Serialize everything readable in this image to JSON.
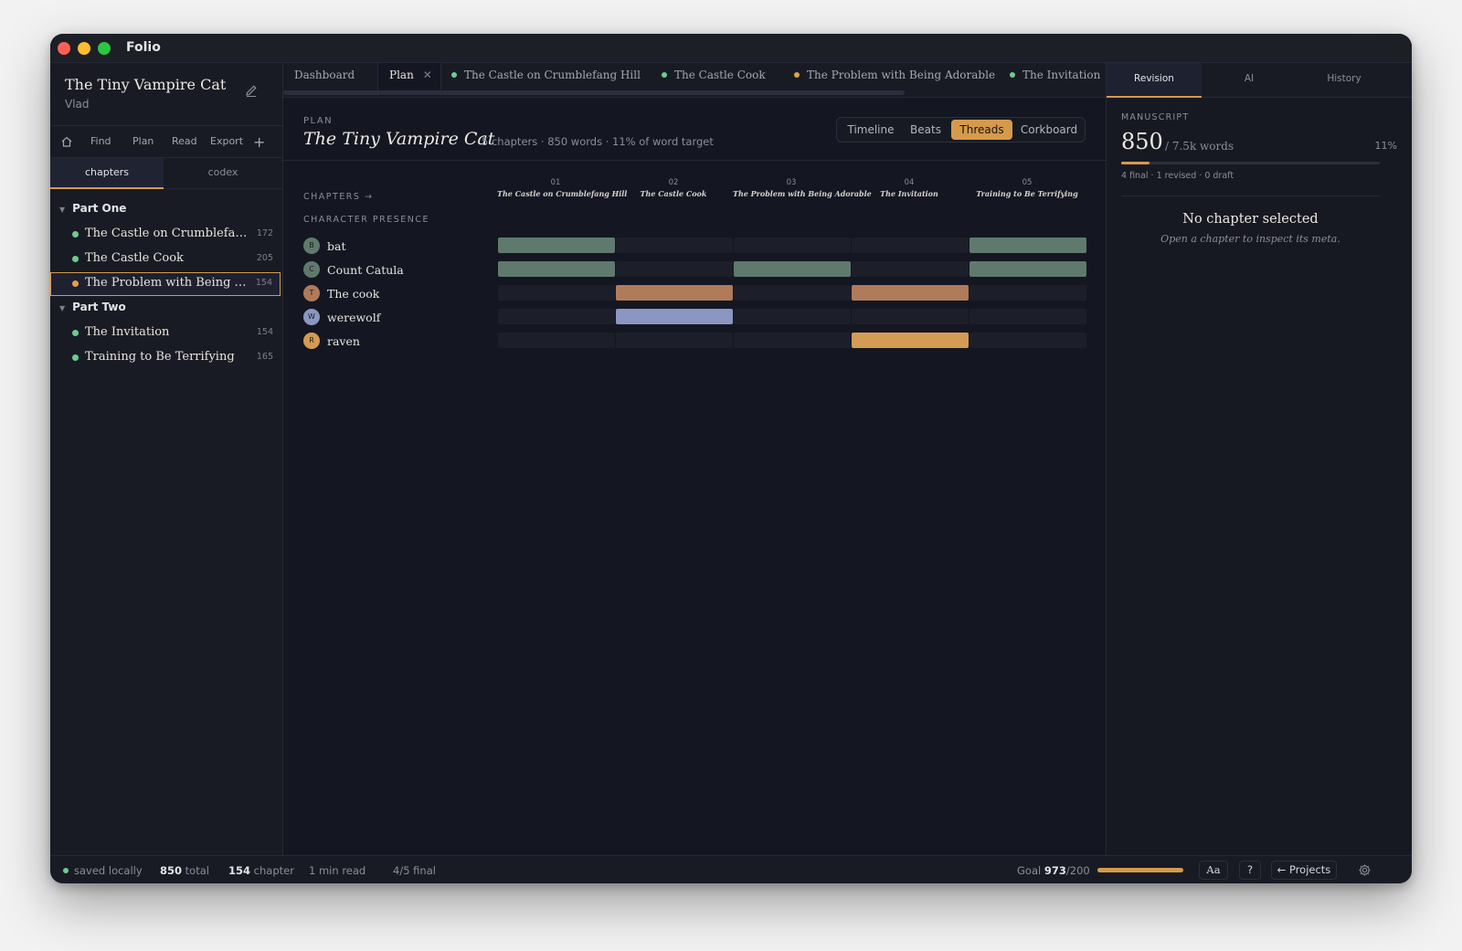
{
  "app": {
    "title": "Folio"
  },
  "sidebar": {
    "project_title": "The Tiny Vampire Cat",
    "author": "Vlad",
    "nav": [
      "Find",
      "Plan",
      "Read",
      "Export"
    ],
    "tabs": [
      "chapters",
      "codex"
    ],
    "parts": [
      {
        "label": "Part One",
        "chapters": [
          {
            "name": "The Castle on Crumblefan...",
            "count": "172",
            "status": "final"
          },
          {
            "name": "The Castle Cook",
            "count": "205",
            "status": "final"
          },
          {
            "name": "The Problem with Being A...",
            "count": "154",
            "status": "revised"
          }
        ]
      },
      {
        "label": "Part Two",
        "chapters": [
          {
            "name": "The Invitation",
            "count": "154",
            "status": "final"
          },
          {
            "name": "Training to Be Terrifying",
            "count": "165",
            "status": "final"
          }
        ]
      }
    ]
  },
  "tabs": [
    {
      "label": "Dashboard"
    },
    {
      "label": "Plan"
    },
    {
      "label": "The Castle on Crumblefang Hill",
      "status": "final"
    },
    {
      "label": "The Castle Cook",
      "status": "final"
    },
    {
      "label": "The Problem with Being Adorable",
      "status": "revised"
    },
    {
      "label": "The Invitation",
      "status": "final"
    }
  ],
  "plan": {
    "kicker": "PLAN",
    "title": "The Tiny Vampire Cat",
    "meta": "5 chapters · 850 words · 11% of word target",
    "views": [
      "Timeline",
      "Beats",
      "Threads",
      "Corkboard"
    ],
    "active_view": "Threads",
    "chapters_label": "CHAPTERS →",
    "presence_label": "CHARACTER PRESENCE",
    "columns": [
      {
        "num": "01",
        "name": "The Castle on Crumblefang Hill"
      },
      {
        "num": "02",
        "name": "The Castle Cook"
      },
      {
        "num": "03",
        "name": "The Problem with Being Adorable"
      },
      {
        "num": "04",
        "name": "The Invitation"
      },
      {
        "num": "05",
        "name": "Training to Be Terrifying"
      }
    ],
    "characters": [
      {
        "initial": "B",
        "name": "bat",
        "color": "#5f7a6c",
        "presence": [
          1,
          0,
          0,
          0,
          1
        ]
      },
      {
        "initial": "C",
        "name": "Count Catula",
        "color": "#5f7a6c",
        "presence": [
          1,
          0,
          1,
          0,
          1
        ]
      },
      {
        "initial": "T",
        "name": "The cook",
        "color": "#b07b5a",
        "presence": [
          0,
          1,
          0,
          1,
          0
        ]
      },
      {
        "initial": "W",
        "name": "werewolf",
        "color": "#8b97c2",
        "presence": [
          0,
          1,
          0,
          0,
          0
        ]
      },
      {
        "initial": "R",
        "name": "raven",
        "color": "#d39b53",
        "presence": [
          0,
          0,
          0,
          1,
          0
        ]
      }
    ]
  },
  "right_panel": {
    "tabs": [
      "Revision",
      "AI",
      "History"
    ],
    "kicker": "MANUSCRIPT",
    "count": "850",
    "target": "/ 7.5k words",
    "percent": "11%",
    "progress": 0.11,
    "status": "4 final · 1 revised · 0 draft",
    "empty_title": "No chapter selected",
    "empty_sub": "Open a chapter to inspect its meta."
  },
  "statusbar": {
    "saved": "saved locally",
    "total_num": "850",
    "total_label": "total",
    "chapter_num": "154",
    "chapter_label": "chapter",
    "read_time": "1 min read",
    "final": "4/5 final",
    "goal_label": "Goal",
    "goal_value": "973",
    "goal_target": "/200",
    "goal_progress": 1.0,
    "font_btn": "Aa",
    "help_btn": "?",
    "projects_btn": "← Projects"
  },
  "colors": {
    "accent": "#d69a4c",
    "status_final": "#6fcb8f",
    "status_revised": "#e0a24e"
  }
}
